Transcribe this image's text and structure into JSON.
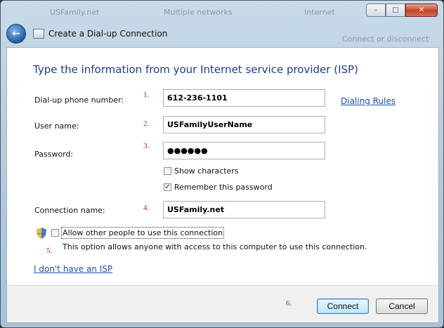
{
  "window": {
    "background_ghost": [
      "USFamily.net",
      "Multiple networks",
      "Internet",
      "Connect or disconnect"
    ],
    "caption_buttons": {
      "minimize": "–",
      "maximize": "□",
      "close": "✕"
    },
    "title": "Create a Dial-up Connection"
  },
  "form": {
    "heading": "Type the information from your Internet service provider (ISP)",
    "phone_label": "Dial-up phone number:",
    "phone_value": "612-236-1101",
    "dialing_rules": "Dialing Rules",
    "username_label": "User name:",
    "username_value": "USFamilyUserName",
    "password_label": "Password:",
    "password_value": "●●●●●●",
    "show_characters": "Show characters",
    "remember_password": "Remember this password",
    "connection_label": "Connection name:",
    "connection_value": "USFamily.net",
    "allow_others": "Allow other people to use this connection",
    "allow_others_desc": "This option allows anyone with access to this computer to use this connection.",
    "no_isp": "I don't have an ISP"
  },
  "annotations": [
    "1.",
    "2.",
    "3.",
    "4.",
    "5.",
    "6."
  ],
  "footer": {
    "connect": "Connect",
    "cancel": "Cancel"
  },
  "state": {
    "show_characters": false,
    "remember_password": true,
    "allow_others": false
  },
  "colors": {
    "heading": "#1e3c8c",
    "annotation": "#c0201d",
    "link": "#1e4fb4"
  }
}
